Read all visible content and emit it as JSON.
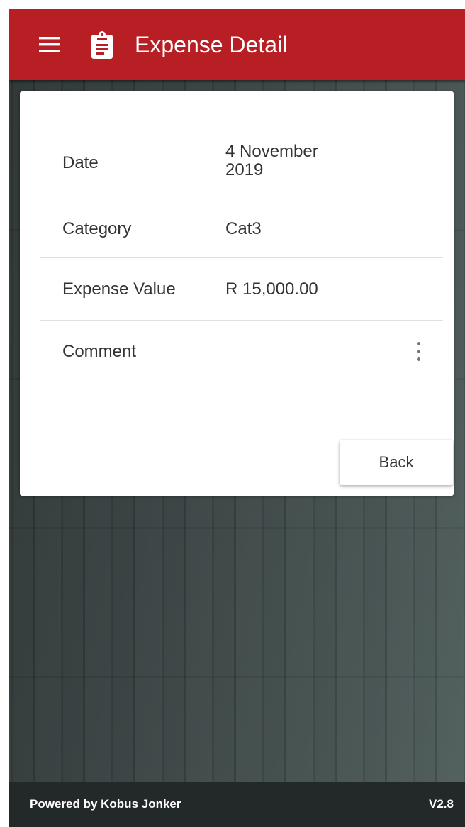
{
  "header": {
    "menu_icon": "hamburger-menu-icon",
    "page_icon": "clipboard-icon",
    "title": "Expense Detail"
  },
  "detail": {
    "rows": [
      {
        "label": "Date",
        "value": "4 November 2019"
      },
      {
        "label": "Category",
        "value": "Cat3"
      },
      {
        "label": "Expense Value",
        "value": "R 15,000.00"
      },
      {
        "label": "Comment",
        "value": "",
        "menu_icon": "more-vertical-icon"
      }
    ],
    "back_label": "Back"
  },
  "footer": {
    "powered_by": "Powered by Kobus Jonker",
    "version": "V2.8"
  },
  "colors": {
    "header_bg": "#b81f24",
    "footer_bg": "#232829",
    "card_bg": "#ffffff",
    "text": "#333333"
  }
}
